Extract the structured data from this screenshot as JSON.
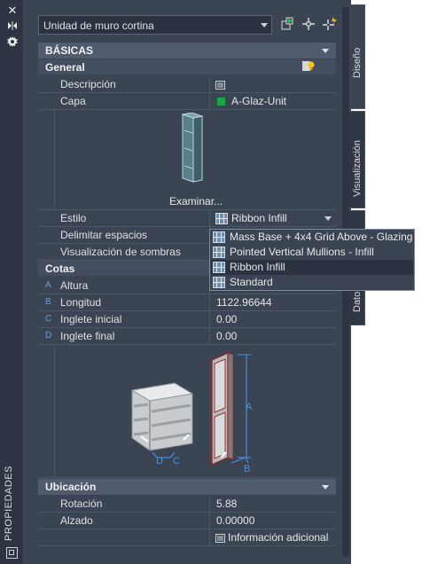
{
  "palette": {
    "title": "PROPIEDADES",
    "object_type": "Unidad de muro cortina",
    "toolbar_icons": [
      "quick-select-icon",
      "select-objects-icon",
      "pickadd-icon"
    ],
    "left_icons": [
      "close-icon",
      "autohide-icon",
      "settings-icon"
    ]
  },
  "tabs": [
    "Diseño",
    "Visualización",
    "Dato"
  ],
  "sections": {
    "basicas": "BÁSICAS",
    "general": "General",
    "cotas": "Cotas",
    "ubicacion": "Ubicación"
  },
  "general": {
    "descripcion_label": "Descripción",
    "capa_label": "Capa",
    "capa_value": "A-Glaz-Unit",
    "capa_color": "#1fa14a",
    "examinar": "Examinar...",
    "estilo_label": "Estilo",
    "estilo_value": "Ribbon Infill",
    "delimitar_label": "Delimitar espacios",
    "sombras_label": "Visualización de sombras"
  },
  "style_dropdown": {
    "options": [
      "Mass Base + 4x4 Grid Above - Glazing",
      "Pointed Vertical Mullions - Infill",
      "Ribbon Infill",
      "Standard"
    ],
    "selected": "Ribbon Infill"
  },
  "cotas": {
    "rows": [
      {
        "letter": "A",
        "label": "Altura",
        "value": ""
      },
      {
        "letter": "B",
        "label": "Longitud",
        "value": "1122.96644"
      },
      {
        "letter": "C",
        "label": "Inglete inicial",
        "value": "0.00"
      },
      {
        "letter": "D",
        "label": "Inglete final",
        "value": "0.00"
      }
    ],
    "diagram_labels": [
      "A",
      "B",
      "C",
      "D"
    ]
  },
  "ubicacion": {
    "rotacion_label": "Rotación",
    "rotacion_value": "5.88",
    "alzado_label": "Alzado",
    "alzado_value": "0.00000",
    "info": "Información adicional"
  }
}
